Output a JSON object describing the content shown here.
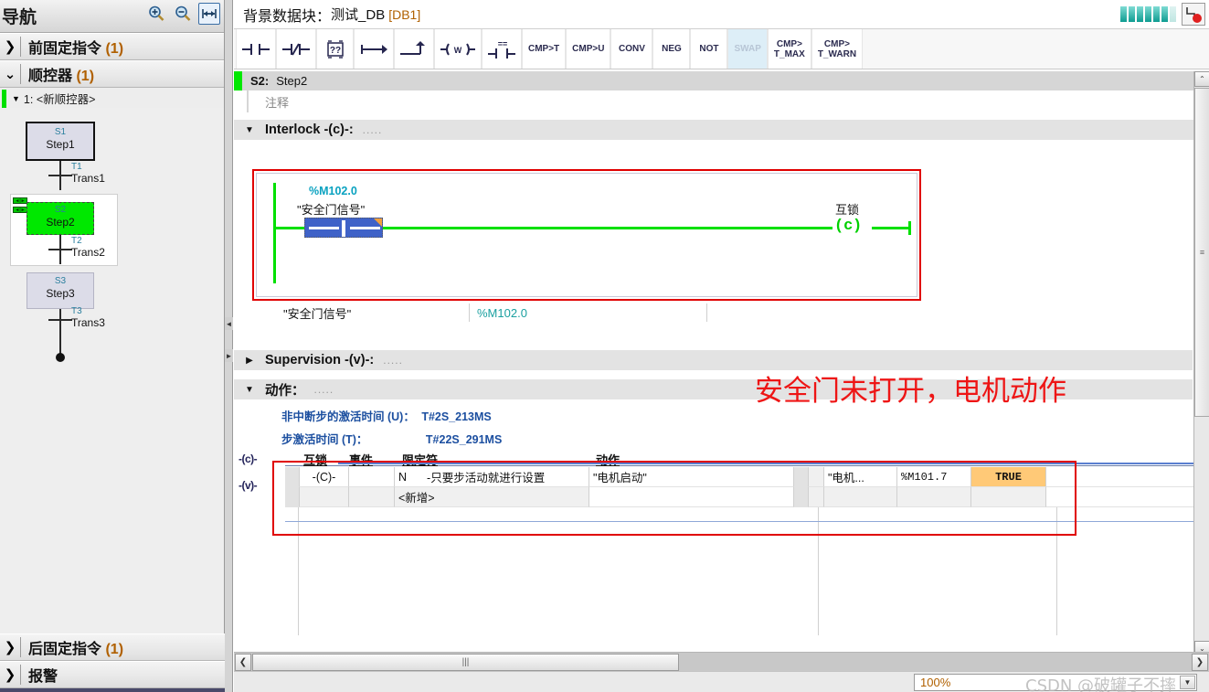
{
  "nav": {
    "header_title": "导航",
    "tools": [
      {
        "name": "zoom-in-icon",
        "label": "+"
      },
      {
        "name": "zoom-out-icon",
        "label": "-"
      },
      {
        "name": "fit-width-icon",
        "label": "↔"
      }
    ],
    "sections": [
      {
        "arrow": "❯",
        "label": "前固定指令",
        "count": "(1)"
      },
      {
        "arrow": "❯",
        "label": "顺控器",
        "count": "(1)"
      }
    ],
    "subitem": {
      "tri": "▼",
      "label": "1: <新顺控器>"
    },
    "bottom_sections": [
      {
        "arrow": "❯",
        "label": "后固定指令",
        "count": "(1)"
      },
      {
        "arrow": "❯",
        "label": "报警",
        "count": ""
      }
    ]
  },
  "sfc": {
    "steps": [
      {
        "id": "S1",
        "label": "Step1",
        "state": "selected"
      },
      {
        "id": "S2",
        "label": "Step2",
        "state": "active"
      },
      {
        "id": "S3",
        "label": "Step3",
        "state": "normal"
      }
    ],
    "transitions": [
      {
        "id": "T1",
        "label": "Trans1"
      },
      {
        "id": "T2",
        "label": "Trans2"
      },
      {
        "id": "T3",
        "label": "Trans3"
      }
    ]
  },
  "editor": {
    "title_cn": "背景数据块：",
    "title_db": "测试_DB",
    "title_bracket": "[DB1]",
    "toolbar": [
      {
        "name": "contact-no-icon",
        "label": "⊣ ⊢",
        "disabled": false
      },
      {
        "name": "contact-nc-icon",
        "label": "⊣/⊢",
        "disabled": false
      },
      {
        "name": "empty-box-icon",
        "label": "[??]",
        "disabled": false
      },
      {
        "name": "open-branch-icon",
        "label": "↦",
        "disabled": false
      },
      {
        "name": "close-branch-icon",
        "label": "⌐↑",
        "disabled": false
      },
      {
        "name": "coil-w-icon",
        "label": "-(W)-",
        "disabled": false
      },
      {
        "name": "compare-eq-icon",
        "label": "⊣==⊢",
        "disabled": false
      },
      {
        "name": "cmp-gt-t-icon",
        "label": "CMP>T",
        "disabled": false
      },
      {
        "name": "cmp-gt-u-icon",
        "label": "CMP>U",
        "disabled": false
      },
      {
        "name": "conv-icon",
        "label": "CONV",
        "disabled": false
      },
      {
        "name": "neg-icon",
        "label": "NEG",
        "disabled": false
      },
      {
        "name": "not-icon",
        "label": "NOT",
        "disabled": false
      },
      {
        "name": "swap-icon",
        "label": "SWAP",
        "disabled": true
      },
      {
        "name": "cmp-t-max-icon",
        "label": "CMP>",
        "label2": "T_MAX",
        "disabled": false
      },
      {
        "name": "cmp-t-warn-icon",
        "label": "CMP>",
        "label2": "T_WARN",
        "disabled": false
      }
    ],
    "step_header": {
      "id": "S2:",
      "name": "Step2",
      "comment": "注释"
    },
    "sections": {
      "interlock": {
        "tri": "▼",
        "label": "Interlock -(c)-:",
        "dots": "....."
      },
      "supervision": {
        "tri": "▶",
        "label": "Supervision -(v)-:",
        "dots": "....."
      },
      "action": {
        "tri": "▼",
        "label": "动作：",
        "dots": "....."
      }
    },
    "ladder": {
      "address": "%M102.0",
      "symbol": "\"安全门信号\"",
      "coil_label": "互锁",
      "coil": "( c )"
    },
    "operand_row": {
      "name": "\"安全门信号\"",
      "address": "%M102.0"
    },
    "times": [
      {
        "label": "非中断步的激活时间 (U)：",
        "value": "T#2S_213MS"
      },
      {
        "label": "步激活时间 (T)：",
        "value": "T#22S_291MS"
      }
    ],
    "annotation": "安全门未打开，电机动作",
    "side_labels": [
      "-(c)-",
      "-(v)-"
    ],
    "action_table": {
      "headers": [
        "互锁",
        "事件",
        "限定符",
        "动作"
      ],
      "rows": [
        {
          "interlock": "-(C)-",
          "event": "",
          "qualifier": "N",
          "qualifier_desc": "-只要步活动就进行设置",
          "action": "\"电机启动\"",
          "monitor_name": "\"电机...",
          "monitor_addr": "%M101.7",
          "monitor_value": "TRUE"
        },
        {
          "interlock": "",
          "event": "",
          "qualifier": "<新增>",
          "qualifier_desc": "",
          "action": "",
          "monitor_name": "",
          "monitor_addr": "",
          "monitor_value": ""
        }
      ]
    }
  },
  "status": {
    "zoom": "100%",
    "watermark": "CSDN @破罐子不摔"
  },
  "scroll": {
    "up_arrow": "⌃",
    "down_arrow": "⌄",
    "left_arrow": "❮",
    "right_arrow": "❯",
    "thumb_grip": "|||"
  }
}
